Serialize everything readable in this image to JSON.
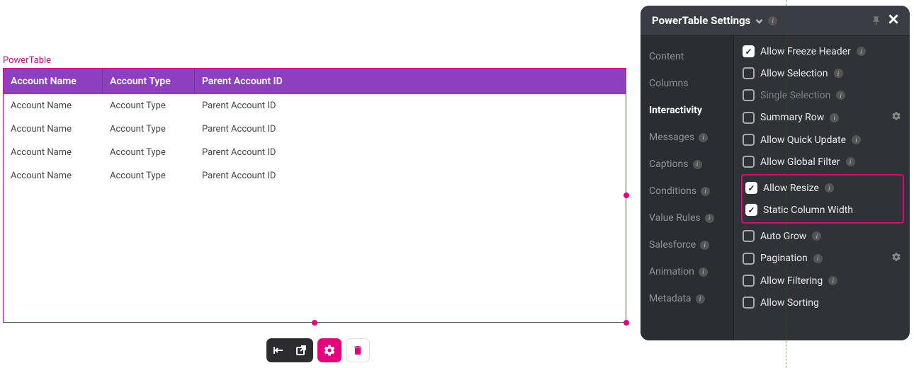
{
  "table": {
    "label": "PowerTable",
    "columns": [
      "Account Name",
      "Account Type",
      "Parent Account ID"
    ],
    "rows": [
      [
        "Account Name",
        "Account Type",
        "Parent Account ID"
      ],
      [
        "Account Name",
        "Account Type",
        "Parent Account ID"
      ],
      [
        "Account Name",
        "Account Type",
        "Parent Account ID"
      ],
      [
        "Account Name",
        "Account Type",
        "Parent Account ID"
      ]
    ]
  },
  "toolbar": {
    "left_icon": "left-align",
    "expand_icon": "open-external",
    "gear_icon": "settings",
    "trash_icon": "delete"
  },
  "panel": {
    "title": "PowerTable Settings",
    "tabs": [
      {
        "label": "Content",
        "active": false,
        "info": false
      },
      {
        "label": "Columns",
        "active": false,
        "info": false
      },
      {
        "label": "Interactivity",
        "active": true,
        "info": false
      },
      {
        "label": "Messages",
        "active": false,
        "info": true
      },
      {
        "label": "Captions",
        "active": false,
        "info": true
      },
      {
        "label": "Conditions",
        "active": false,
        "info": true
      },
      {
        "label": "Value Rules",
        "active": false,
        "info": true
      },
      {
        "label": "Salesforce",
        "active": false,
        "info": true
      },
      {
        "label": "Animation",
        "active": false,
        "info": true
      },
      {
        "label": "Metadata",
        "active": false,
        "info": true
      }
    ],
    "options": [
      {
        "label": "Allow Freeze Header",
        "checked": true,
        "info": true,
        "gear": false,
        "disabled": false
      },
      {
        "label": "Allow Selection",
        "checked": false,
        "info": true,
        "gear": false,
        "disabled": false
      },
      {
        "label": "Single Selection",
        "checked": false,
        "info": true,
        "gear": false,
        "disabled": true
      },
      {
        "label": "Summary Row",
        "checked": false,
        "info": true,
        "gear": true,
        "disabled": false
      },
      {
        "label": "Allow Quick Update",
        "checked": false,
        "info": true,
        "gear": false,
        "disabled": false
      },
      {
        "label": "Allow Global Filter",
        "checked": false,
        "info": true,
        "gear": false,
        "disabled": false
      },
      {
        "label": "Allow Resize",
        "checked": true,
        "info": true,
        "gear": false,
        "disabled": false
      },
      {
        "label": "Static Column Width",
        "checked": true,
        "info": false,
        "gear": false,
        "disabled": false
      },
      {
        "label": "Auto Grow",
        "checked": false,
        "info": true,
        "gear": false,
        "disabled": false
      },
      {
        "label": "Pagination",
        "checked": false,
        "info": true,
        "gear": true,
        "disabled": false
      },
      {
        "label": "Allow Filtering",
        "checked": false,
        "info": true,
        "gear": false,
        "disabled": false
      },
      {
        "label": "Allow Sorting",
        "checked": false,
        "info": false,
        "gear": false,
        "disabled": false
      }
    ],
    "highlighted_options": [
      "Allow Resize",
      "Static Column Width"
    ]
  }
}
